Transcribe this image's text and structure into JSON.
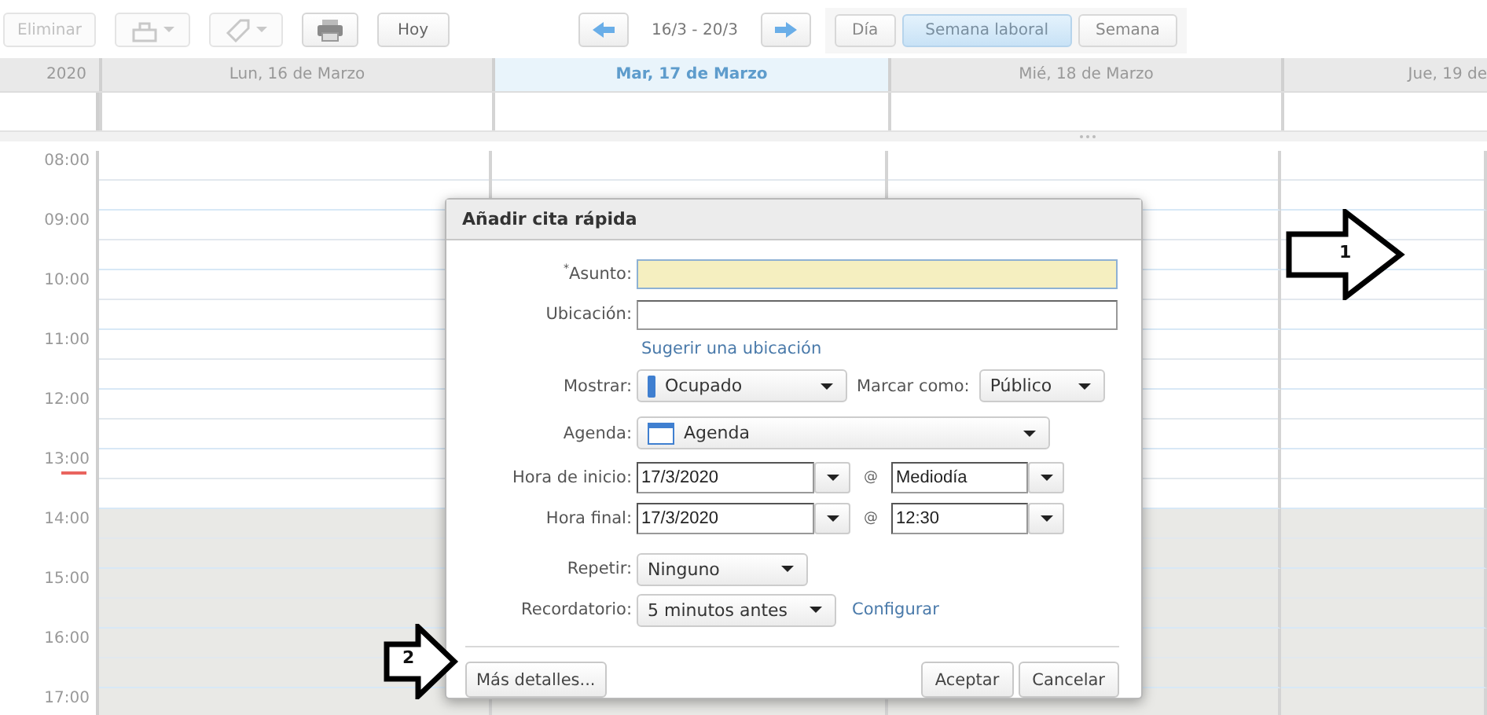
{
  "toolbar": {
    "buttons": [
      {
        "kind": "text",
        "label": "Eliminar",
        "disabled": true
      },
      {
        "kind": "new-menu",
        "disabled": true
      },
      {
        "kind": "tag-menu",
        "disabled": true
      },
      {
        "kind": "print",
        "disabled": false
      },
      {
        "kind": "text",
        "label": "Hoy",
        "disabled": false
      }
    ],
    "range": "16/3 - 20/3",
    "views": [
      {
        "label": "Día",
        "selected": false
      },
      {
        "label": "Semana laboral",
        "selected": true
      },
      {
        "label": "Semana",
        "selected": false
      }
    ]
  },
  "calendar": {
    "year": "2020",
    "days": [
      {
        "label": "Lun, 16 de Marzo",
        "today": false
      },
      {
        "label": "Mar, 17 de Marzo",
        "today": true
      },
      {
        "label": "Mié, 18 de Marzo",
        "today": false
      },
      {
        "label": "Jue, 19 de",
        "today": false
      }
    ],
    "hours": [
      {
        "label": "08:00",
        "now": false,
        "shaded": false
      },
      {
        "label": "09:00",
        "now": false,
        "shaded": false
      },
      {
        "label": "10:00",
        "now": false,
        "shaded": false
      },
      {
        "label": "11:00",
        "now": false,
        "shaded": false
      },
      {
        "label": "12:00",
        "now": false,
        "shaded": false
      },
      {
        "label": "13:00",
        "now": true,
        "shaded": false
      },
      {
        "label": "14:00",
        "now": false,
        "shaded": true
      },
      {
        "label": "15:00",
        "now": false,
        "shaded": true
      },
      {
        "label": "16:00",
        "now": false,
        "shaded": true
      },
      {
        "label": "17:00",
        "now": false,
        "shaded": true
      }
    ]
  },
  "dialog": {
    "title": "Añadir cita rápida",
    "fields": [
      {
        "kind": "input",
        "label": "$^{*}$Asunto:",
        "highlighted": true
      },
      {
        "kind": "input",
        "label": "Ubicación:",
        "highlighted": false
      },
      {
        "kind": "link",
        "text": "Sugerir una ubicación"
      },
      {
        "kind": "show",
        "label": "Mostrar:",
        "value": "Ocupado",
        "second_label": "Marcar como:",
        "second_value": "Público"
      },
      {
        "kind": "calendar",
        "label": "Agenda:",
        "value": "Agenda"
      },
      {
        "kind": "datetime",
        "label": "Hora de inicio:",
        "date": "17/3/2020",
        "at": "@",
        "time": "Mediodía"
      },
      {
        "kind": "datetime",
        "label": "Hora final:",
        "date": "17/3/2020",
        "at": "@",
        "time": "12:30"
      },
      {
        "kind": "select",
        "label": "Repetir:",
        "value": "Ninguno"
      },
      {
        "kind": "select",
        "label": "Recordatorio:",
        "value": "5 minutos antes",
        "link": "Configurar"
      }
    ],
    "more_button": "Más detalles...",
    "buttons": [
      "Aceptar",
      "Cancelar"
    ]
  },
  "callouts": [
    {
      "number": "1"
    },
    {
      "number": "2"
    }
  ]
}
